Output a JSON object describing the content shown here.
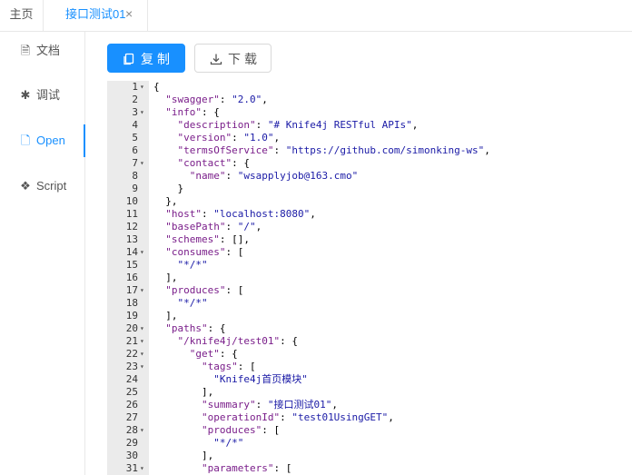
{
  "tabs": {
    "home": "主页",
    "active": "接口测试01",
    "close": "×"
  },
  "sidebar": {
    "items": [
      {
        "label": "文档",
        "icon": "document-icon",
        "glyph": "🗎"
      },
      {
        "label": "调试",
        "icon": "bug-icon",
        "glyph": "✱"
      },
      {
        "label": "Open",
        "icon": "file-icon",
        "glyph": "🗋"
      },
      {
        "label": "Script",
        "icon": "code-icon",
        "glyph": "❖"
      }
    ]
  },
  "toolbar": {
    "copy_label": "复制",
    "copy_icon": "copy-icon",
    "download_label": "下载",
    "download_icon": "download-icon"
  },
  "editor": {
    "lines": [
      {
        "n": "1",
        "f": "▾",
        "t": "{"
      },
      {
        "n": "2",
        "f": "",
        "t": "  \"swagger\": \"2.0\","
      },
      {
        "n": "3",
        "f": "▾",
        "t": "  \"info\": {"
      },
      {
        "n": "4",
        "f": "",
        "t": "    \"description\": \"# Knife4j RESTful APIs\","
      },
      {
        "n": "5",
        "f": "",
        "t": "    \"version\": \"1.0\","
      },
      {
        "n": "6",
        "f": "",
        "t": "    \"termsOfService\": \"https://github.com/simonking-ws\","
      },
      {
        "n": "7",
        "f": "▾",
        "t": "    \"contact\": {"
      },
      {
        "n": "8",
        "f": "",
        "t": "      \"name\": \"wsapplyjob@163.cmo\""
      },
      {
        "n": "9",
        "f": "",
        "t": "    }"
      },
      {
        "n": "10",
        "f": "",
        "t": "  },"
      },
      {
        "n": "11",
        "f": "",
        "t": "  \"host\": \"localhost:8080\","
      },
      {
        "n": "12",
        "f": "",
        "t": "  \"basePath\": \"/\","
      },
      {
        "n": "13",
        "f": "",
        "t": "  \"schemes\": [],"
      },
      {
        "n": "14",
        "f": "▾",
        "t": "  \"consumes\": ["
      },
      {
        "n": "15",
        "f": "",
        "t": "    \"*/*\""
      },
      {
        "n": "16",
        "f": "",
        "t": "  ],"
      },
      {
        "n": "17",
        "f": "▾",
        "t": "  \"produces\": ["
      },
      {
        "n": "18",
        "f": "",
        "t": "    \"*/*\""
      },
      {
        "n": "19",
        "f": "",
        "t": "  ],"
      },
      {
        "n": "20",
        "f": "▾",
        "t": "  \"paths\": {"
      },
      {
        "n": "21",
        "f": "▾",
        "t": "    \"/knife4j/test01\": {"
      },
      {
        "n": "22",
        "f": "▾",
        "t": "      \"get\": {"
      },
      {
        "n": "23",
        "f": "▾",
        "t": "        \"tags\": ["
      },
      {
        "n": "24",
        "f": "",
        "t": "          \"Knife4j首页模块\""
      },
      {
        "n": "25",
        "f": "",
        "t": "        ],"
      },
      {
        "n": "26",
        "f": "",
        "t": "        \"summary\": \"接口测试01\","
      },
      {
        "n": "27",
        "f": "",
        "t": "        \"operationId\": \"test01UsingGET\","
      },
      {
        "n": "28",
        "f": "▾",
        "t": "        \"produces\": ["
      },
      {
        "n": "29",
        "f": "",
        "t": "          \"*/*\""
      },
      {
        "n": "30",
        "f": "",
        "t": "        ],"
      },
      {
        "n": "31",
        "f": "▾",
        "t": "        \"parameters\": ["
      }
    ]
  }
}
